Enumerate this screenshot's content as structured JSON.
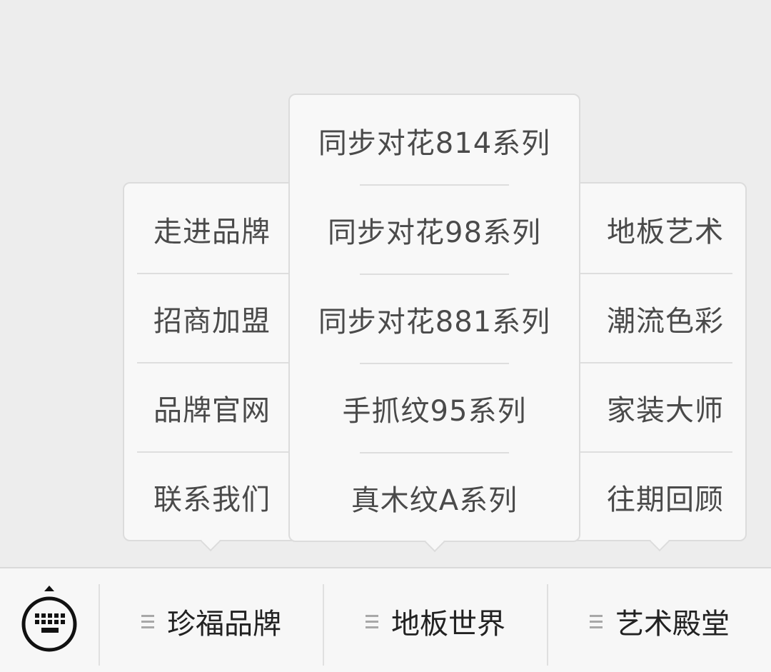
{
  "menus": {
    "brand": [
      "走进品牌",
      "招商加盟",
      "品牌官网",
      "联系我们"
    ],
    "floor": [
      "同步对花814系列",
      "同步对花98系列",
      "同步对花881系列",
      "手抓纹95系列",
      "真木纹A系列"
    ],
    "art": [
      "地板艺术",
      "潮流色彩",
      "家装大师",
      "往期回顾"
    ]
  },
  "tabs": {
    "brand": "珍福品牌",
    "floor": "地板世界",
    "art": "艺术殿堂"
  },
  "icons": {
    "keyboard": "keyboard-icon",
    "menu": "menu-lines-icon"
  },
  "colors": {
    "background": "#ededed",
    "popup": "#f8f8f8",
    "text": "#4a4a4a"
  }
}
